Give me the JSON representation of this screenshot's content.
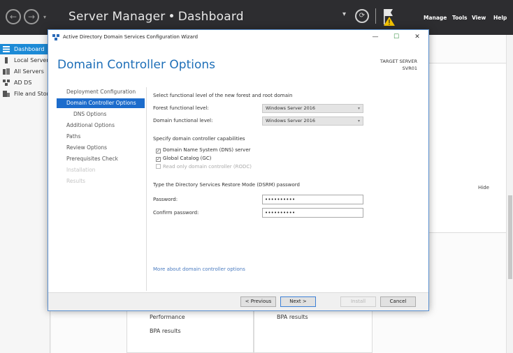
{
  "server_manager": {
    "title": "Server Manager",
    "breadcrumb_sep": "•",
    "page": "Dashboard",
    "nav_back_glyph": "←",
    "nav_forward_glyph": "→",
    "nav_dropdown_glyph": "▾",
    "refresh_glyph": "▾",
    "notifications_glyph": "⟳",
    "menu": [
      "Manage",
      "Tools",
      "View",
      "Help"
    ],
    "sidebar": [
      {
        "label": "Dashboard",
        "icon": "dashboard-icon"
      },
      {
        "label": "Local Server",
        "icon": "server-icon"
      },
      {
        "label": "All Servers",
        "icon": "servers-icon"
      },
      {
        "label": "AD DS",
        "icon": "ad-ds-icon"
      },
      {
        "label": "File and Storage Services",
        "icon": "file-storage-icon"
      }
    ],
    "hide_label": "Hide",
    "bottom_left": [
      "Performance",
      "BPA results"
    ],
    "bottom_right": [
      "BPA results"
    ]
  },
  "wizard": {
    "window_title": "Active Directory Domain Services Configuration Wizard",
    "controls": {
      "minimize": "—",
      "maximize": "☐",
      "close": "✕"
    },
    "heading": "Domain Controller Options",
    "target_server_label": "TARGET SERVER",
    "target_server_name": "SVR01",
    "nav": [
      {
        "label": "Deployment Configuration",
        "state": "normal"
      },
      {
        "label": "Domain Controller Options",
        "state": "active"
      },
      {
        "label": "DNS Options",
        "state": "sub"
      },
      {
        "label": "Additional Options",
        "state": "normal"
      },
      {
        "label": "Paths",
        "state": "normal"
      },
      {
        "label": "Review Options",
        "state": "normal"
      },
      {
        "label": "Prerequisites Check",
        "state": "normal"
      },
      {
        "label": "Installation",
        "state": "disabled"
      },
      {
        "label": "Results",
        "state": "disabled"
      }
    ],
    "functional_level_intro": "Select functional level of the new forest and root domain",
    "forest_level_label": "Forest functional level:",
    "forest_level_value": "Windows Server 2016",
    "domain_level_label": "Domain functional level:",
    "domain_level_value": "Windows Server 2016",
    "capabilities_intro": "Specify domain controller capabilities",
    "capabilities": [
      {
        "label": "Domain Name System (DNS) server",
        "checked": true,
        "enabled": true
      },
      {
        "label": "Global Catalog (GC)",
        "checked": true,
        "enabled": false
      },
      {
        "label": "Read only domain controller (RODC)",
        "checked": false,
        "enabled": false
      }
    ],
    "dsrm_intro": "Type the Directory Services Restore Mode (DSRM) password",
    "password_label": "Password:",
    "password_value": "••••••••••",
    "confirm_label": "Confirm password:",
    "confirm_value": "••••••••••",
    "more_link": "More about domain controller options",
    "buttons": {
      "previous": "< Previous",
      "next": "Next >",
      "install": "Install",
      "cancel": "Cancel"
    },
    "check_glyph": "✓",
    "select_chevron": "▾"
  }
}
